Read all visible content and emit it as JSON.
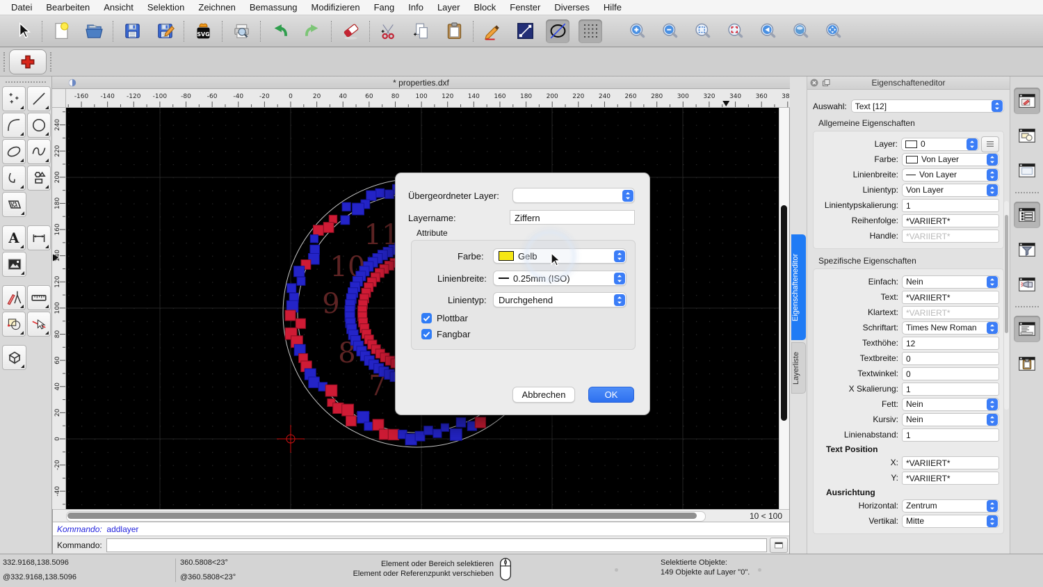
{
  "menu": {
    "items": [
      "Datei",
      "Bearbeiten",
      "Ansicht",
      "Selektion",
      "Zeichnen",
      "Bemassung",
      "Modifizieren",
      "Fang",
      "Info",
      "Layer",
      "Block",
      "Fenster",
      "Diverses",
      "Hilfe"
    ]
  },
  "toolbar": {
    "buttons": [
      {
        "name": "pointer"
      },
      {
        "sep": true
      },
      {
        "name": "new-file"
      },
      {
        "name": "open-folder"
      },
      {
        "sep": true
      },
      {
        "name": "save"
      },
      {
        "name": "save-as"
      },
      {
        "sep": true
      },
      {
        "name": "svg-export"
      },
      {
        "sep": true
      },
      {
        "name": "print-preview"
      },
      {
        "sep": true
      },
      {
        "name": "undo"
      },
      {
        "name": "redo"
      },
      {
        "sep": true
      },
      {
        "name": "eraser"
      },
      {
        "sep": true
      },
      {
        "name": "cut"
      },
      {
        "name": "copy"
      },
      {
        "name": "paste"
      },
      {
        "sep": true
      },
      {
        "name": "pencil"
      },
      {
        "name": "line-tool"
      },
      {
        "name": "ellipse-tool",
        "pressed": true
      },
      {
        "name": "grid-tool",
        "pressed": true
      },
      {
        "gap": 20
      },
      {
        "name": "zoom-in"
      },
      {
        "name": "zoom-out"
      },
      {
        "name": "zoom-auto"
      },
      {
        "name": "zoom-selection"
      },
      {
        "name": "zoom-previous"
      },
      {
        "name": "zoom-window"
      },
      {
        "name": "zoom-pan"
      }
    ]
  },
  "sub_toolbar": {
    "buttons": [
      {
        "name": "plus-tool"
      }
    ]
  },
  "palette": {
    "rows": [
      [
        "points",
        "line"
      ],
      [
        "arc",
        "circle"
      ],
      [
        "ellipse",
        "spline"
      ],
      [
        "polyline",
        "shapes"
      ],
      [
        "hatch",
        null
      ],
      null,
      [
        "text",
        "dimension"
      ],
      [
        "image",
        null
      ],
      null,
      [
        "drafting",
        "measure"
      ],
      [
        "modify",
        "select-modify"
      ],
      null,
      [
        "solid",
        null
      ]
    ]
  },
  "document": {
    "title": "* properties.dxf",
    "zoom_info": "10 < 100"
  },
  "rulers": {
    "h_start": -160,
    "h_end": 360,
    "h_step": 20,
    "v_start": 240,
    "v_end": -40,
    "v_step": -20
  },
  "canvas": {
    "numerals": [
      "11",
      "10",
      "9",
      "8",
      "7"
    ],
    "colors": {
      "background": "#000000",
      "square_blue": "#2424c8",
      "square_red": "#cf1b35",
      "numeral": "#5e2424",
      "circle": "#c8c8c8",
      "crosshair": "#cc1111",
      "grid_dot": "#2f2f2f",
      "grid_line": "#232323"
    }
  },
  "dialog": {
    "parent_layer_label": "Übergeordneter Layer:",
    "layer_name_label": "Layername:",
    "layer_name_value": "Ziffern",
    "attributes_label": "Attribute",
    "color_label": "Farbe:",
    "color_value": "Gelb",
    "color_hex": "#f5e614",
    "linewidth_label": "Linienbreite:",
    "linewidth_value": "0.25mm (ISO)",
    "linetype_label": "Linientyp:",
    "linetype_value": "Durchgehend",
    "plottable_label": "Plottbar",
    "snappable_label": "Fangbar",
    "cancel_label": "Abbrechen",
    "ok_label": "OK"
  },
  "panel": {
    "title": "Eigenschafteneditor",
    "selection_label": "Auswahl:",
    "selection_value": "Text [12]",
    "general_header": "Allgemeine Eigenschaften",
    "general_rows": [
      {
        "label": "Layer:",
        "value": "0",
        "type": "combo",
        "swatch": "rect",
        "menu": true
      },
      {
        "label": "Farbe:",
        "value": "Von Layer",
        "type": "combo",
        "swatch": "rect"
      },
      {
        "label": "Linienbreite:",
        "value": "Von Layer",
        "type": "combo",
        "swatch": "line"
      },
      {
        "label": "Linientyp:",
        "value": "Von Layer",
        "type": "combo"
      },
      {
        "label": "Linientypskalierung:",
        "value": "1",
        "type": "input"
      },
      {
        "label": "Reihenfolge:",
        "value": "*VARIIERT*",
        "type": "input"
      },
      {
        "label": "Handle:",
        "value": "*VARIIERT*",
        "type": "input",
        "disabled": true
      }
    ],
    "specific_header": "Spezifische Eigenschaften",
    "specific_rows": [
      {
        "label": "Einfach:",
        "value": "Nein",
        "type": "combo"
      },
      {
        "label": "Text:",
        "value": "*VARIIERT*",
        "type": "input"
      },
      {
        "label": "Klartext:",
        "value": "*VARIIERT*",
        "type": "input",
        "disabled": true
      },
      {
        "label": "Schriftart:",
        "value": "Times New Roman",
        "type": "combo"
      },
      {
        "label": "Texthöhe:",
        "value": "12",
        "type": "input"
      },
      {
        "label": "Textbreite:",
        "value": "0",
        "type": "input"
      },
      {
        "label": "Textwinkel:",
        "value": "0",
        "type": "input"
      },
      {
        "label": "X Skalierung:",
        "value": "1",
        "type": "input"
      },
      {
        "label": "Fett:",
        "value": "Nein",
        "type": "combo"
      },
      {
        "label": "Kursiv:",
        "value": "Nein",
        "type": "combo"
      },
      {
        "label": "Linienabstand:",
        "value": "1",
        "type": "input"
      },
      {
        "header": "Text Position"
      },
      {
        "label": "X:",
        "value": "*VARIIERT*",
        "type": "input"
      },
      {
        "label": "Y:",
        "value": "*VARIIERT*",
        "type": "input"
      },
      {
        "header": "Ausrichtung"
      },
      {
        "label": "Horizontal:",
        "value": "Zentrum",
        "type": "combo"
      },
      {
        "label": "Vertikal:",
        "value": "Mitte",
        "type": "combo"
      }
    ]
  },
  "side_tabs": {
    "tabs": [
      {
        "label": "Eigenschafteneditor",
        "active": true
      },
      {
        "label": "Layerliste",
        "active": false
      }
    ]
  },
  "right_strip": {
    "buttons": [
      {
        "name": "property-editor-panel",
        "pressed": true
      },
      {
        "name": "layer-list-panel"
      },
      {
        "name": "blank-panel"
      },
      {
        "sep": true
      },
      {
        "name": "list-panel",
        "pressed": true
      },
      {
        "name": "filter-panel"
      },
      {
        "name": "flashlight-panel"
      },
      {
        "sep": true
      },
      {
        "name": "command-line-panel",
        "pressed": true
      },
      {
        "name": "clipboard-panel"
      }
    ]
  },
  "command": {
    "history_label": "Kommando:",
    "history_value": "addlayer",
    "prompt_label": "Kommando:",
    "input_value": ""
  },
  "status": {
    "abs_coord": "332.9168,138.5096",
    "rel_coord": "@332.9168,138.5096",
    "abs_polar": "360.5808<23°",
    "rel_polar": "@360.5808<23°",
    "hint_line1": "Element oder Bereich selektieren",
    "hint_line2": "Element oder Referenzpunkt verschieben",
    "selected_label": "Selektierte Objekte:",
    "selected_value": "149 Objekte auf Layer \"0\"."
  }
}
